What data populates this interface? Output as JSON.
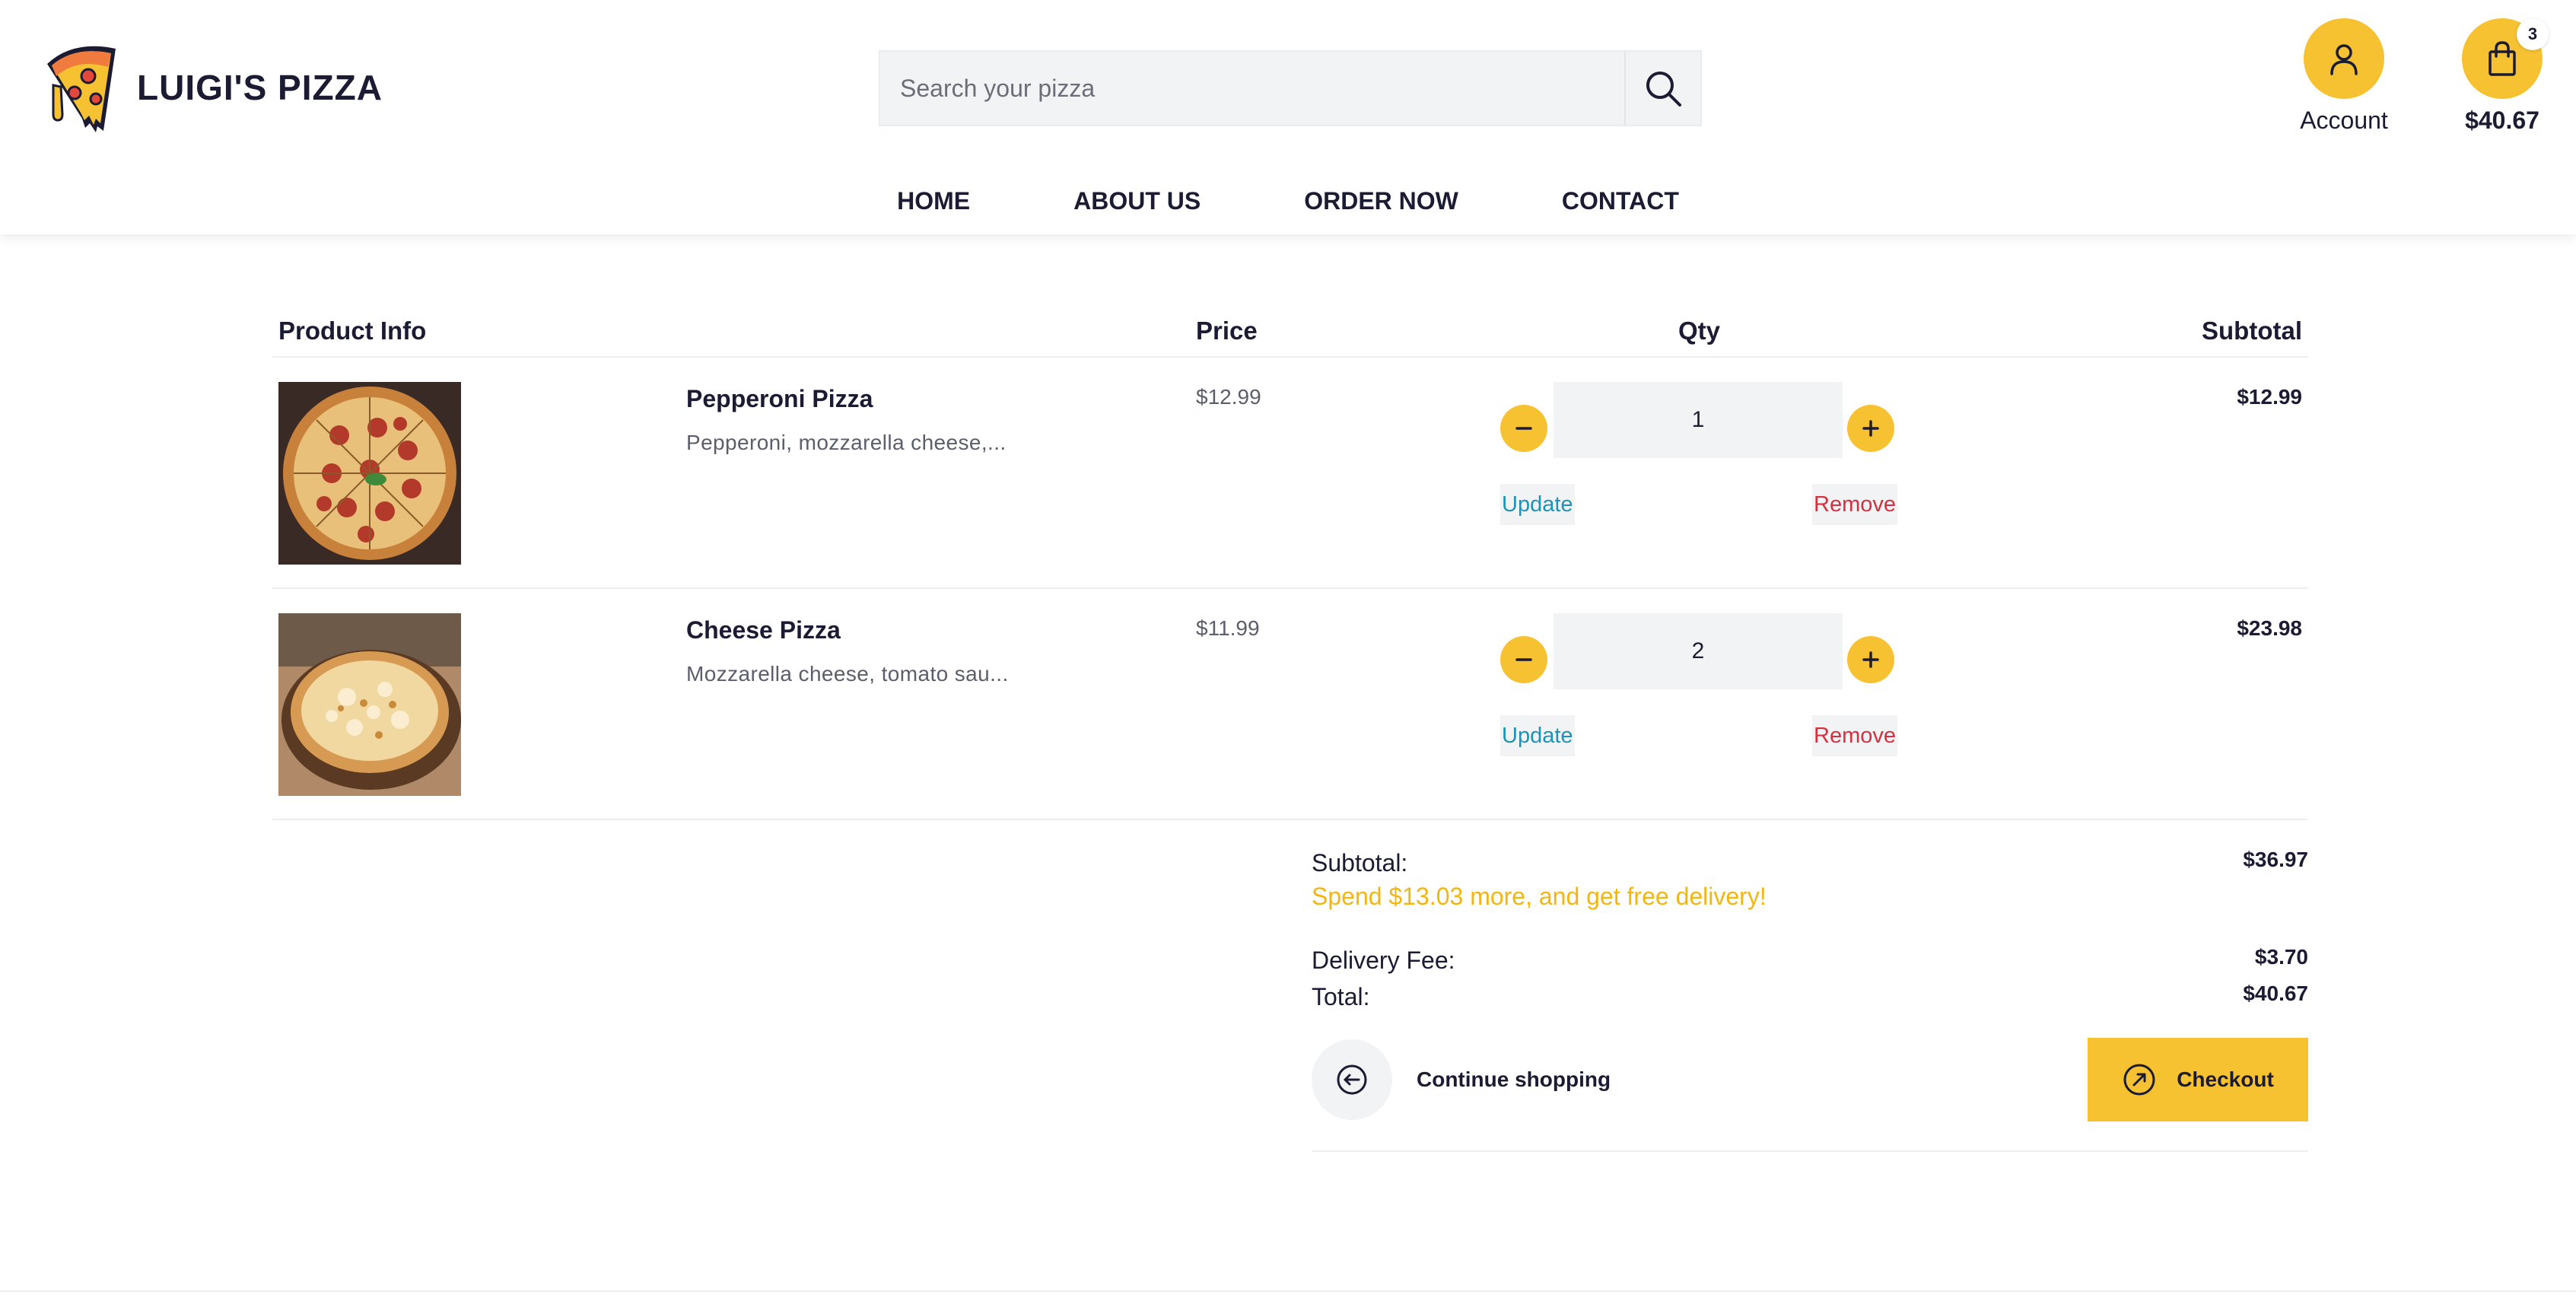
{
  "brand": {
    "name": "LUIGI'S PIZZA",
    "logo_icon": "pizza-slice-icon"
  },
  "search": {
    "placeholder": "Search your pizza",
    "value": "",
    "icon": "search-icon"
  },
  "account": {
    "label": "Account",
    "icon": "user-icon"
  },
  "cart": {
    "count": "3",
    "total": "$40.67",
    "icon": "shopping-bag-icon"
  },
  "nav": {
    "items": [
      "HOME",
      "ABOUT US",
      "ORDER NOW",
      "CONTACT"
    ]
  },
  "table": {
    "headers": {
      "product": "Product Info",
      "price": "Price",
      "qty": "Qty",
      "subtotal": "Subtotal"
    },
    "items": [
      {
        "name": "Pepperoni Pizza",
        "description": "Pepperoni, mozzarella cheese,...",
        "price": "$12.99",
        "qty": "1",
        "subtotal": "$12.99",
        "update_label": "Update",
        "remove_label": "Remove"
      },
      {
        "name": "Cheese Pizza",
        "description": "Mozzarella cheese, tomato sau...",
        "price": "$11.99",
        "qty": "2",
        "subtotal": "$23.98",
        "update_label": "Update",
        "remove_label": "Remove"
      }
    ]
  },
  "summary": {
    "subtotal_label": "Subtotal:",
    "subtotal_value": "$36.97",
    "promo": "Spend $13.03 more, and get free delivery!",
    "delivery_label": "Delivery Fee:",
    "delivery_value": "$3.70",
    "total_label": "Total:",
    "total_value": "$40.67",
    "continue_label": "Continue shopping",
    "checkout_label": "Checkout"
  },
  "colors": {
    "accent": "#f6c232",
    "text": "#1b1b33",
    "promo": "#f3b610",
    "update": "#1d93b8",
    "remove": "#d6303e",
    "muted": "#5b5e6b"
  }
}
